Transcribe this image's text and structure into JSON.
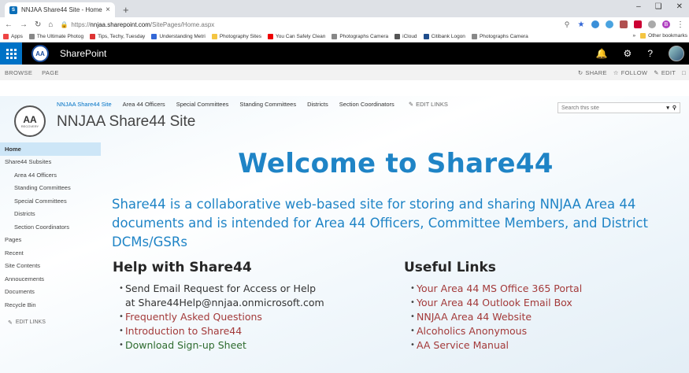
{
  "browser": {
    "tab_title": "NNJAA Share44 Site - Home",
    "tab_close": "×",
    "new_tab": "+",
    "url_scheme": "https://",
    "url_host": "nnjaa.sharepoint.com",
    "url_path": "/SitePages/Home.aspx",
    "bookmarks": [
      {
        "label": "Apps",
        "color": "#e44"
      },
      {
        "label": "The Ultimate Photog",
        "color": "#888"
      },
      {
        "label": "Tips, Techy, Tuesday",
        "color": "#d33"
      },
      {
        "label": "Understanding Metri",
        "color": "#3367d6"
      },
      {
        "label": "Photography Sites",
        "color": "#f4c542"
      },
      {
        "label": "You Can Safely Clean",
        "color": "#e00"
      },
      {
        "label": "Photographs Camera",
        "color": "#888"
      },
      {
        "label": "iCloud",
        "color": "#555"
      },
      {
        "label": "Citibank Logon",
        "color": "#1f4d8c"
      },
      {
        "label": "Photographs Camera",
        "color": "#888"
      }
    ],
    "other_bookmarks": "Other bookmarks",
    "more_bookmarks": "»",
    "ext_initial": "B"
  },
  "suite": {
    "title": "SharePoint",
    "logo_text": "AA"
  },
  "ribbon": {
    "tabs": [
      "BROWSE",
      "PAGE"
    ],
    "share": "SHARE",
    "follow": "FOLLOW",
    "edit": "EDIT"
  },
  "site": {
    "logo_text": "AA",
    "logo_ring": "RECOVERY",
    "title": "NNJAA Share44 Site",
    "search_placeholder": "Search this site",
    "topnav": [
      "NNJAA Share44 Site",
      "Area 44 Officers",
      "Special Committees",
      "Standing Committees",
      "Districts",
      "Section Coordinators"
    ],
    "edit_links": "EDIT LINKS"
  },
  "leftnav": {
    "items": [
      {
        "label": "Home",
        "level": 0,
        "active": true
      },
      {
        "label": "Share44 Subsites",
        "level": 0
      },
      {
        "label": "Area 44 Officers",
        "level": 1
      },
      {
        "label": "Standing Committees",
        "level": 1
      },
      {
        "label": "Special Committees",
        "level": 1
      },
      {
        "label": "Districts",
        "level": 1
      },
      {
        "label": "Section Coordinators",
        "level": 1
      },
      {
        "label": "Pages",
        "level": 0
      },
      {
        "label": "Recent",
        "level": 0
      },
      {
        "label": "Site Contents",
        "level": 0
      },
      {
        "label": "Annoucements",
        "level": 0
      },
      {
        "label": "Documents",
        "level": 0
      },
      {
        "label": "Recycle Bin",
        "level": 0
      }
    ],
    "edit_links": "EDIT LINKS"
  },
  "main": {
    "welcome": "Welcome to Share44",
    "intro": "Share44 is a collaborative  web-based site for storing and sharing NNJAA Area 44 documents and is intended for Area 44 Officers, Committee Members, and District DCMs/GSRs",
    "help": {
      "heading": "Help with Share44",
      "items": [
        {
          "text": "Send Email Request for Access or Help",
          "style": "plain"
        },
        {
          "text": "Frequently Asked Questions",
          "style": "link"
        },
        {
          "text": "Introduction to Share44",
          "style": "link"
        },
        {
          "text": "Download Sign-up Sheet",
          "style": "green"
        }
      ],
      "email": "at Share44Help@nnjaa.onmicrosoft.com"
    },
    "links": {
      "heading": "Useful Links",
      "items": [
        "Your Area 44 MS Office 365 Portal",
        "Your Area 44 Outlook Email Box",
        "NNJAA Area 44 Website",
        "Alcoholics Anonymous",
        "AA Service Manual"
      ]
    }
  },
  "colors": {
    "accent": "#1f84c6",
    "link": "#a33a3a",
    "suite_blue": "#0072c6"
  }
}
